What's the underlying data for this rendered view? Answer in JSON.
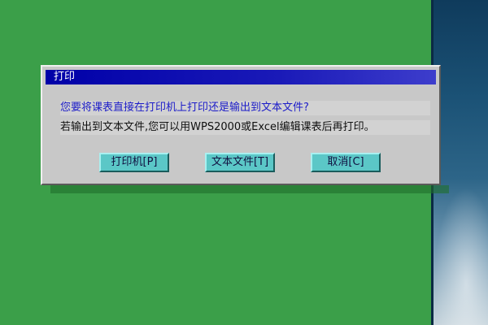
{
  "dialog": {
    "title": "打印",
    "message_line1": "您要将课表直接在打印机上打印还是输出到文本文件?",
    "message_line2": "若输出到文本文件,您可以用WPS2000或Excel编辑课表后再打印。",
    "buttons": {
      "printer": "打印机[P]",
      "text_file": "文本文件[T]",
      "cancel": "取消[C]"
    }
  },
  "colors": {
    "desktop": "#3b9f49",
    "title_bar": "#0000a8",
    "dialog_bg": "#c8c8c8",
    "button_bg": "#5bc7c7",
    "message_primary": "#1c1cc8"
  }
}
